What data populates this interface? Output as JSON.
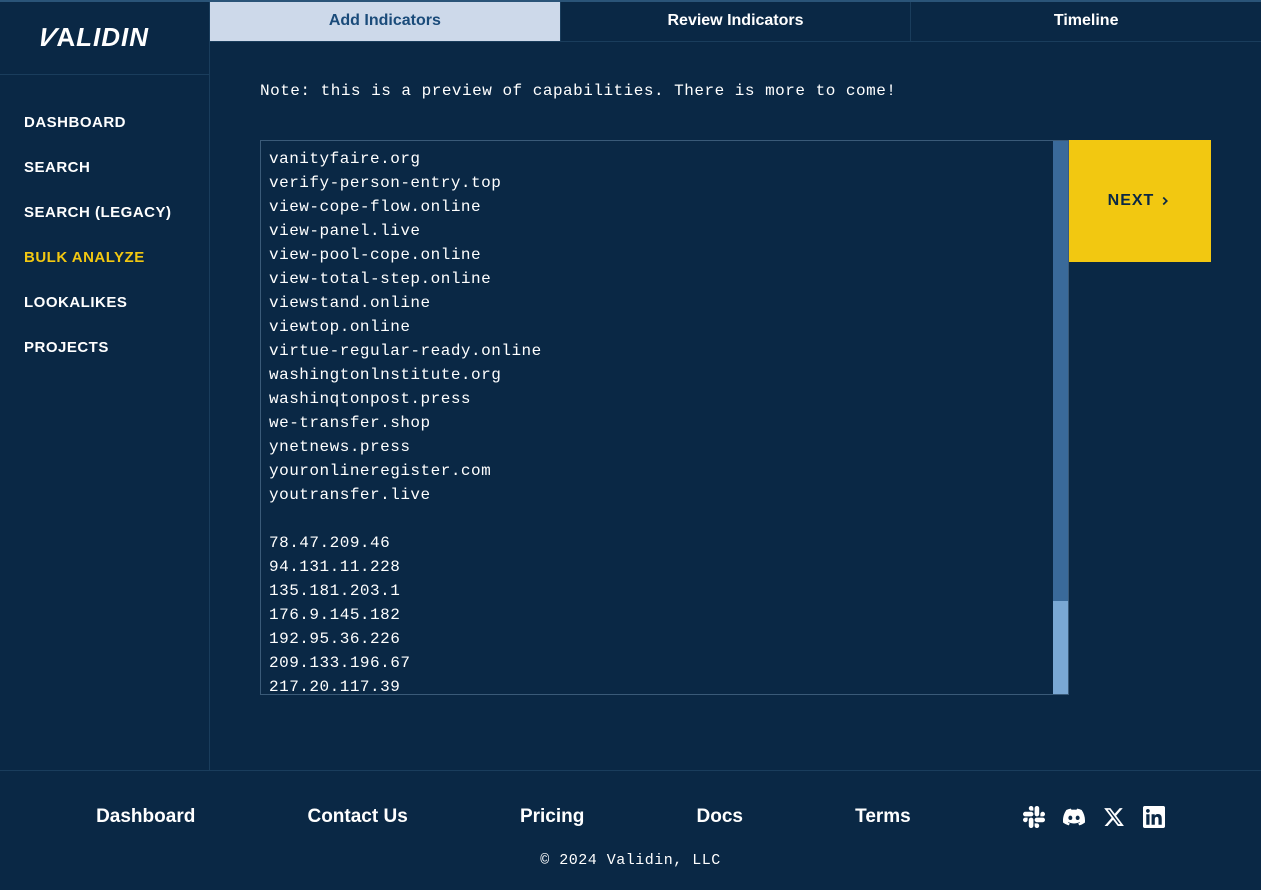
{
  "brand": "VALIDIN",
  "sidebar": {
    "items": [
      {
        "label": "DASHBOARD"
      },
      {
        "label": "SEARCH"
      },
      {
        "label": "SEARCH (LEGACY)"
      },
      {
        "label": "BULK ANALYZE"
      },
      {
        "label": "LOOKALIKES"
      },
      {
        "label": "PROJECTS"
      }
    ],
    "active_index": 3
  },
  "tabs": {
    "items": [
      {
        "label": "Add Indicators"
      },
      {
        "label": "Review Indicators"
      },
      {
        "label": "Timeline"
      }
    ],
    "active_index": 0
  },
  "note": "Note: this is a preview of capabilities. There is more to come!",
  "indicators_text": "vanityfaire.org\nverify-person-entry.top\nview-cope-flow.online\nview-panel.live\nview-pool-cope.online\nview-total-step.online\nviewstand.online\nviewtop.online\nvirtue-regular-ready.online\nwashingtonlnstitute.org\nwashinqtonpost.press\nwe-transfer.shop\nynetnews.press\nyouronlineregister.com\nyoutransfer.live\n\n78.47.209.46\n94.131.11.228\n135.181.203.1\n176.9.145.182\n192.95.36.226\n209.133.196.67\n217.20.117.39",
  "next_label": "NEXT",
  "footer": {
    "links": [
      {
        "label": "Dashboard"
      },
      {
        "label": "Contact Us"
      },
      {
        "label": "Pricing"
      },
      {
        "label": "Docs"
      },
      {
        "label": "Terms"
      }
    ],
    "copyright": "© 2024 Validin, LLC"
  }
}
